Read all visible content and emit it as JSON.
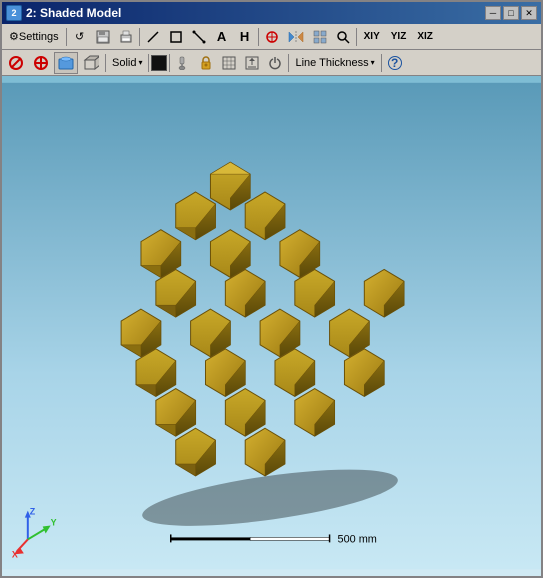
{
  "window": {
    "title": "2: Shaded Model",
    "icon_label": "2"
  },
  "title_buttons": {
    "minimize": "─",
    "maximize": "□",
    "close": "✕"
  },
  "toolbar1": {
    "settings_label": "Settings",
    "buttons": [
      {
        "name": "refresh",
        "icon": "↺"
      },
      {
        "name": "save",
        "icon": "💾"
      },
      {
        "name": "print",
        "icon": "🖨"
      },
      {
        "name": "line",
        "icon": "/"
      },
      {
        "name": "rect",
        "icon": "□"
      },
      {
        "name": "diagonal",
        "icon": "╱"
      },
      {
        "name": "text-A",
        "icon": "A"
      },
      {
        "name": "text-H",
        "icon": "H"
      },
      {
        "name": "snap",
        "icon": "✛"
      },
      {
        "name": "mirror",
        "icon": "⇌"
      },
      {
        "name": "icon1",
        "icon": "⊞"
      },
      {
        "name": "search",
        "icon": "🔍"
      },
      {
        "name": "xyz",
        "icon": "XIY"
      },
      {
        "name": "yiz",
        "icon": "YIZ"
      },
      {
        "name": "xiz",
        "icon": "XIZ"
      }
    ]
  },
  "toolbar2": {
    "no_icon": "⊘",
    "no2_icon": "⊗",
    "view_icon": "👁",
    "solid_label": "Solid",
    "solid_dropdown": "▾",
    "color_swatch": "",
    "brush_icon": "🖌",
    "lock_icon": "🔒",
    "grid_icon": "⊞",
    "export_icon": "⬜",
    "power_icon": "⏻",
    "line_thickness_label": "Line Thickness",
    "dropdown_arrow": "▾",
    "help_icon": "?"
  },
  "scale": {
    "label": "500 mm"
  },
  "axes": {
    "x_color": "#e83030",
    "y_color": "#30c030",
    "z_color": "#3060e8"
  },
  "colors": {
    "hex_face": "#b8a030",
    "hex_edge": "#888020",
    "hex_dark": "#7a6818",
    "background_top": "#4a8aaa",
    "background_bottom": "#c0dff0"
  }
}
